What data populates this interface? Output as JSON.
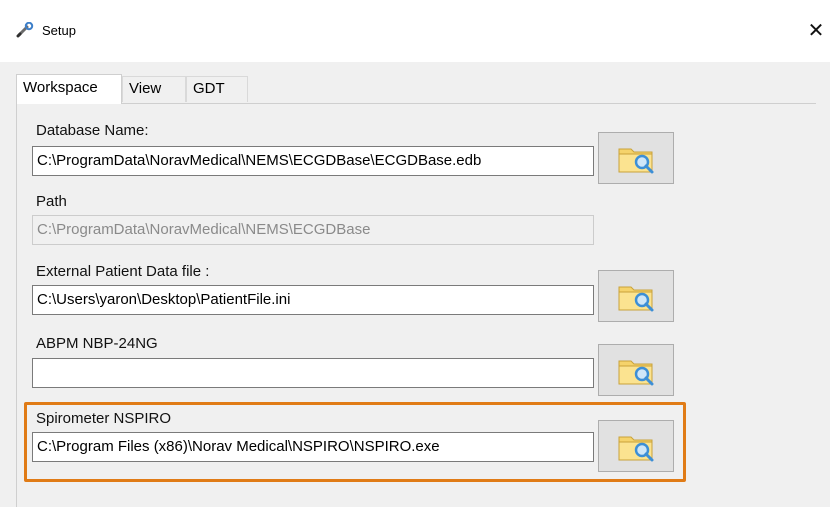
{
  "window": {
    "title": "Setup",
    "close_glyph": "✕",
    "icon": "wrench-icon"
  },
  "tabs": [
    {
      "label": "Workspace",
      "active": true
    },
    {
      "label": "View",
      "active": false
    },
    {
      "label": "GDT",
      "active": false
    }
  ],
  "fields": {
    "database_name": {
      "label": "Database Name:",
      "value": "C:\\ProgramData\\NoravMedical\\NEMS\\ECGDBase\\ECGDBase.edb"
    },
    "path": {
      "label": "Path",
      "value": "C:\\ProgramData\\NoravMedical\\NEMS\\ECGDBase",
      "enabled": false
    },
    "external_patient_data": {
      "label": "External Patient Data file  :",
      "value": "C:\\Users\\yaron\\Desktop\\PatientFile.ini"
    },
    "abpm": {
      "label": "ABPM NBP-24NG",
      "value": ""
    },
    "spirometer": {
      "label": "Spirometer NSPIRO",
      "value": "C:\\Program Files (x86)\\Norav Medical\\NSPIRO\\NSPIRO.exe"
    }
  },
  "browse_icon": "folder-search-icon",
  "colors": {
    "highlight": "#e07b16",
    "folder": "#f5d36b",
    "magnifier": "#3d8fd6"
  }
}
